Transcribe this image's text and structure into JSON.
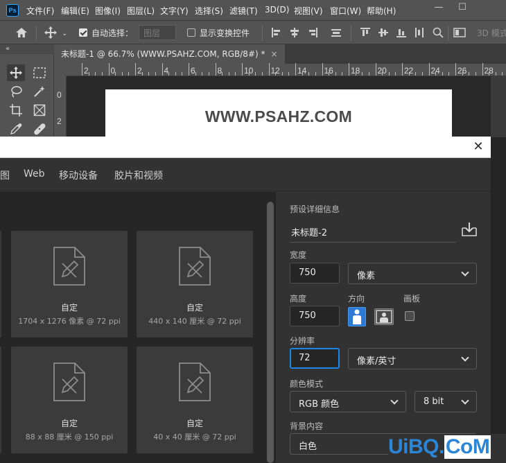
{
  "menubar": {
    "app_icon": "Ps",
    "items": [
      "文件(F)",
      "编辑(E)",
      "图像(I)",
      "图层(L)",
      "文字(Y)",
      "选择(S)",
      "滤镜(T)",
      "3D(D)",
      "视图(V)",
      "窗口(W)",
      "帮助(H)"
    ],
    "window_controls": [
      "—",
      "☐"
    ]
  },
  "options_bar": {
    "auto_select_label": "自动选择：",
    "auto_select_checked": true,
    "auto_select_target": "图层",
    "show_transform_label": "显示变换控件",
    "show_transform_checked": false,
    "mode_3d_label": "3D 模式"
  },
  "toolbar": {
    "collapse_glyph": "«",
    "tools": [
      "move-tool",
      "marquee-tool",
      "lasso-tool",
      "magic-wand-tool",
      "crop-tool",
      "frame-tool",
      "eyedropper-tool",
      "healing-brush-tool"
    ]
  },
  "document_tab": {
    "title": "未标题-1 @ 66.7% (WWW.PSAHZ.COM, RGB/8#) *",
    "close": "×"
  },
  "ruler": {
    "horizontal_labels": [
      "2",
      "0",
      "2",
      "4",
      "6",
      "8",
      "10",
      "12",
      "14",
      "16",
      "18",
      "20",
      "22",
      "24",
      "26",
      "28"
    ],
    "vertical_labels": [
      "0",
      "2"
    ]
  },
  "canvas": {
    "text": "WWW.PSAHZ.COM"
  },
  "dialog": {
    "close": "✕",
    "tabs": [
      "图",
      "Web",
      "移动设备",
      "胶片和视频"
    ],
    "presets": [
      {
        "name": "自定",
        "meta": "1704 x 1276 像素 @ 72 ppi"
      },
      {
        "name": "自定",
        "meta": "440 x 140 厘米 @ 72 ppi"
      },
      {
        "name": "自定",
        "meta": "88 x 88 厘米 @ 150 ppi"
      },
      {
        "name": "自定",
        "meta": "40 x 40 厘米 @ 72 ppi"
      }
    ],
    "details": {
      "heading": "预设详细信息",
      "document_name": "未标题-2",
      "width_label": "宽度",
      "width_value": "750",
      "width_unit": "像素",
      "height_label": "高度",
      "height_value": "750",
      "orientation_label": "方向",
      "artboard_label": "画板",
      "resolution_label": "分辨率",
      "resolution_value": "72",
      "resolution_unit": "像素/英寸",
      "color_mode_label": "颜色模式",
      "color_mode_value": "RGB 颜色",
      "bit_depth_value": "8 bit",
      "background_label": "背景内容",
      "background_value": "白色"
    }
  },
  "watermark": {
    "part1": "UiBQ.",
    "part2": "CoM"
  },
  "colors": {
    "accent_blue": "#1c88e8",
    "panel": "#323232",
    "chrome": "#535353"
  }
}
